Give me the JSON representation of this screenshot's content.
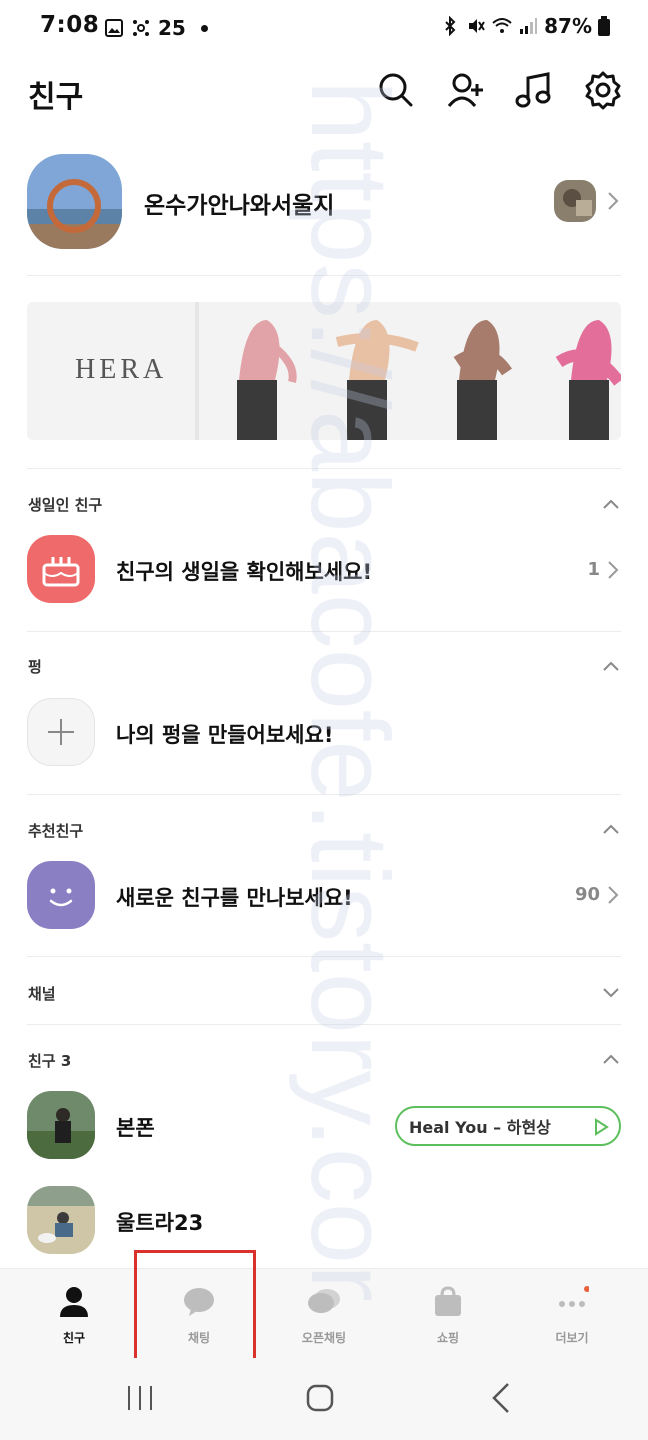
{
  "status_bar": {
    "time": "7:08",
    "notif_count": "25",
    "battery": "87%"
  },
  "header": {
    "title": "친구",
    "icons": [
      "search-icon",
      "add-friend-icon",
      "music-icon",
      "settings-icon"
    ]
  },
  "profile": {
    "name": "온수가안나와서울지"
  },
  "banner": {
    "brand": "HERA"
  },
  "sections": {
    "birthday": {
      "header": "생일인 친구",
      "text": "친구의 생일을 확인해보세요!",
      "count": "1"
    },
    "pung": {
      "header": "펑",
      "text": "나의 펑을 만들어보세요!"
    },
    "recommend": {
      "header": "추천친구",
      "text": "새로운 친구를 만나보세요!",
      "count": "90"
    },
    "channel": {
      "header": "채널"
    },
    "friends": {
      "header": "친구 3",
      "items": [
        {
          "name": "본폰",
          "music": "Heal You – 하현상"
        },
        {
          "name": "울트라23"
        }
      ]
    }
  },
  "tabbar": {
    "tabs": [
      {
        "label": "친구",
        "active": true
      },
      {
        "label": "채팅",
        "active": false
      },
      {
        "label": "오픈채팅",
        "active": false
      },
      {
        "label": "쇼핑",
        "active": false
      },
      {
        "label": "더보기",
        "active": false
      }
    ]
  },
  "colors": {
    "highlight": "#d9312b",
    "birthday_icon_bg": "#ef6b6b",
    "recommend_icon_bg": "#8b7fc4",
    "music_pill_border": "#5cbf5c",
    "notification_dot": "#e8603c"
  },
  "watermark": "https://abacofe.tistory.com"
}
